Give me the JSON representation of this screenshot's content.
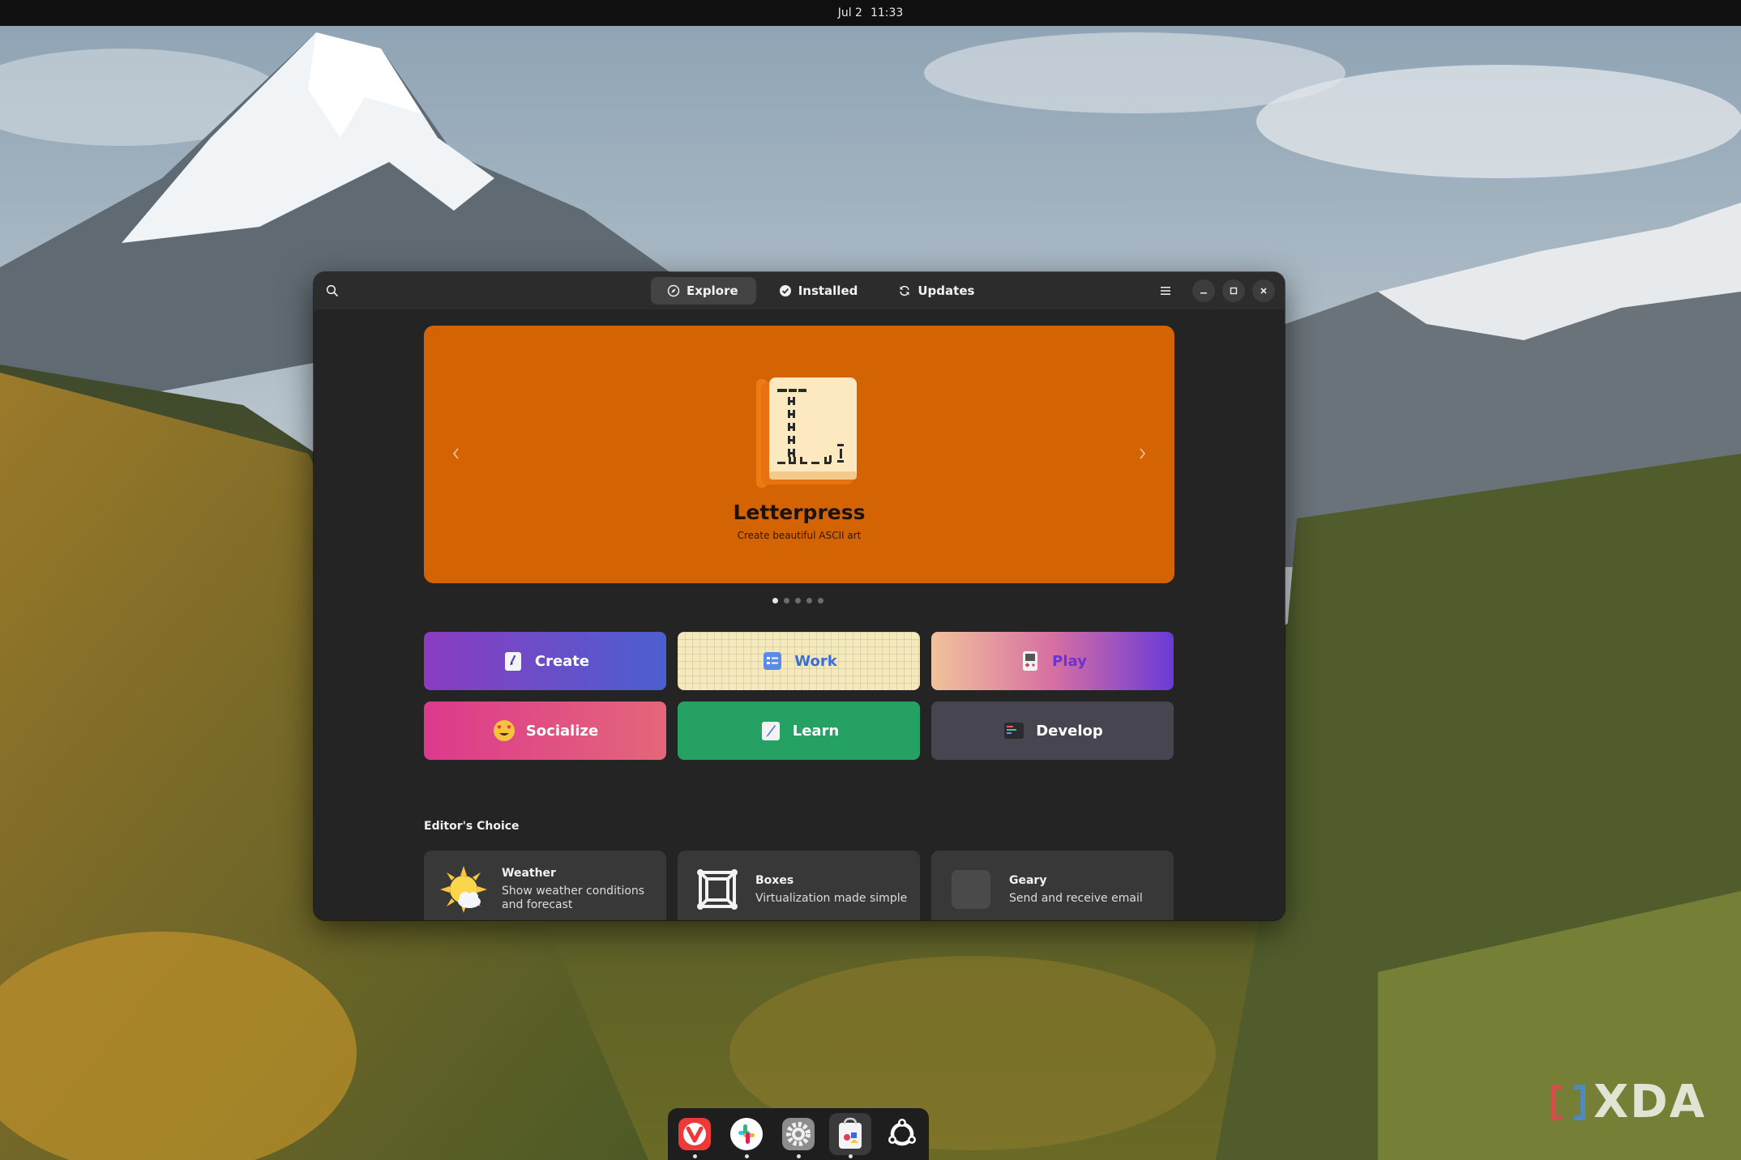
{
  "topbar": {
    "date": "Jul 2",
    "time": "11:33"
  },
  "window": {
    "tabs": [
      {
        "label": "Explore",
        "icon": "compass-icon",
        "active": true
      },
      {
        "label": "Installed",
        "icon": "check-circle-icon",
        "active": false
      },
      {
        "label": "Updates",
        "icon": "refresh-icon",
        "active": false
      }
    ]
  },
  "carousel": {
    "title": "Letterpress",
    "subtitle": "Create beautiful ASCII art",
    "background": "#d46303",
    "page_count": 5,
    "current_page": 1
  },
  "categories": [
    {
      "label": "Create",
      "icon": "paint-card-icon"
    },
    {
      "label": "Work",
      "icon": "checklist-icon"
    },
    {
      "label": "Play",
      "icon": "gameboy-icon"
    },
    {
      "label": "Socialize",
      "icon": "heart-eyes-emoji-icon"
    },
    {
      "label": "Learn",
      "icon": "notebook-pencil-icon"
    },
    {
      "label": "Develop",
      "icon": "terminal-icon"
    }
  ],
  "editors_choice": {
    "title": "Editor's Choice",
    "apps": [
      {
        "name": "Weather",
        "description": "Show weather conditions and forecast",
        "icon": "sun-cloud-icon"
      },
      {
        "name": "Boxes",
        "description": "Virtualization made simple",
        "icon": "boxes-icon"
      },
      {
        "name": "Geary",
        "description": "Send and receive email",
        "icon": "app-placeholder-icon"
      }
    ]
  },
  "dock": [
    {
      "name": "Vivaldi",
      "icon": "vivaldi-icon",
      "running": true
    },
    {
      "name": "Slack",
      "icon": "slack-icon",
      "running": true
    },
    {
      "name": "Settings",
      "icon": "settings-gear-icon",
      "running": true
    },
    {
      "name": "Software",
      "icon": "software-bag-icon",
      "running": true,
      "active": true
    },
    {
      "name": "Show Apps",
      "icon": "ubuntu-logo-icon",
      "running": false
    }
  ],
  "watermark": {
    "text": "XDA"
  }
}
